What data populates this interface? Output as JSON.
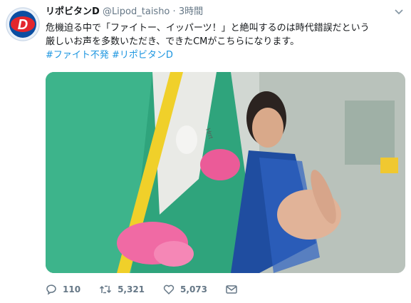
{
  "tweet": {
    "name": "リポビタンD",
    "handle": "@Lipod_taisho",
    "separator": "·",
    "time": "3時間",
    "text_line1": "危機迫る中で「ファイトー、イッパーツ！」と絶叫するのは時代錯誤だという",
    "text_line2": "厳しいお声を多数いただき、できたCMがこちらになります。",
    "hashtags": "#ファイト不発 #リポビタンD",
    "avatar_letter": "D",
    "media_text": "Hrrt",
    "replies": "110",
    "retweets": "5,321",
    "likes": "5,073"
  },
  "colors": {
    "link": "#1b95e0",
    "brand_red": "#e3262d",
    "brand_blue": "#0b4ea2",
    "muted": "#657786"
  },
  "icons": {
    "reply": "speech-bubble-icon",
    "retweet": "retweet-icon",
    "like": "heart-icon",
    "dm": "envelope-icon",
    "menu": "chevron-down-icon"
  }
}
